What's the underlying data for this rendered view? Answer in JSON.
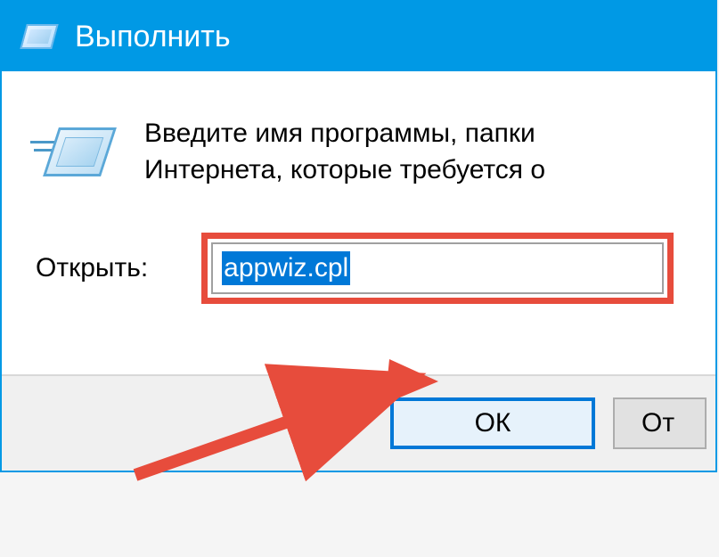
{
  "titlebar": {
    "title": "Выполнить"
  },
  "content": {
    "info_text_line1": "Введите имя программы, папки",
    "info_text_line2": "Интернета, которые требуется о",
    "open_label": "Открыть:",
    "input_value": "appwiz.cpl"
  },
  "buttons": {
    "ok_label": "ОК",
    "cancel_label": "От"
  },
  "colors": {
    "titlebar_bg": "#0099e5",
    "highlight_border": "#e74c3c",
    "selection_bg": "#0078d7",
    "arrow_color": "#e74c3c",
    "focus_border": "#0078d7"
  }
}
